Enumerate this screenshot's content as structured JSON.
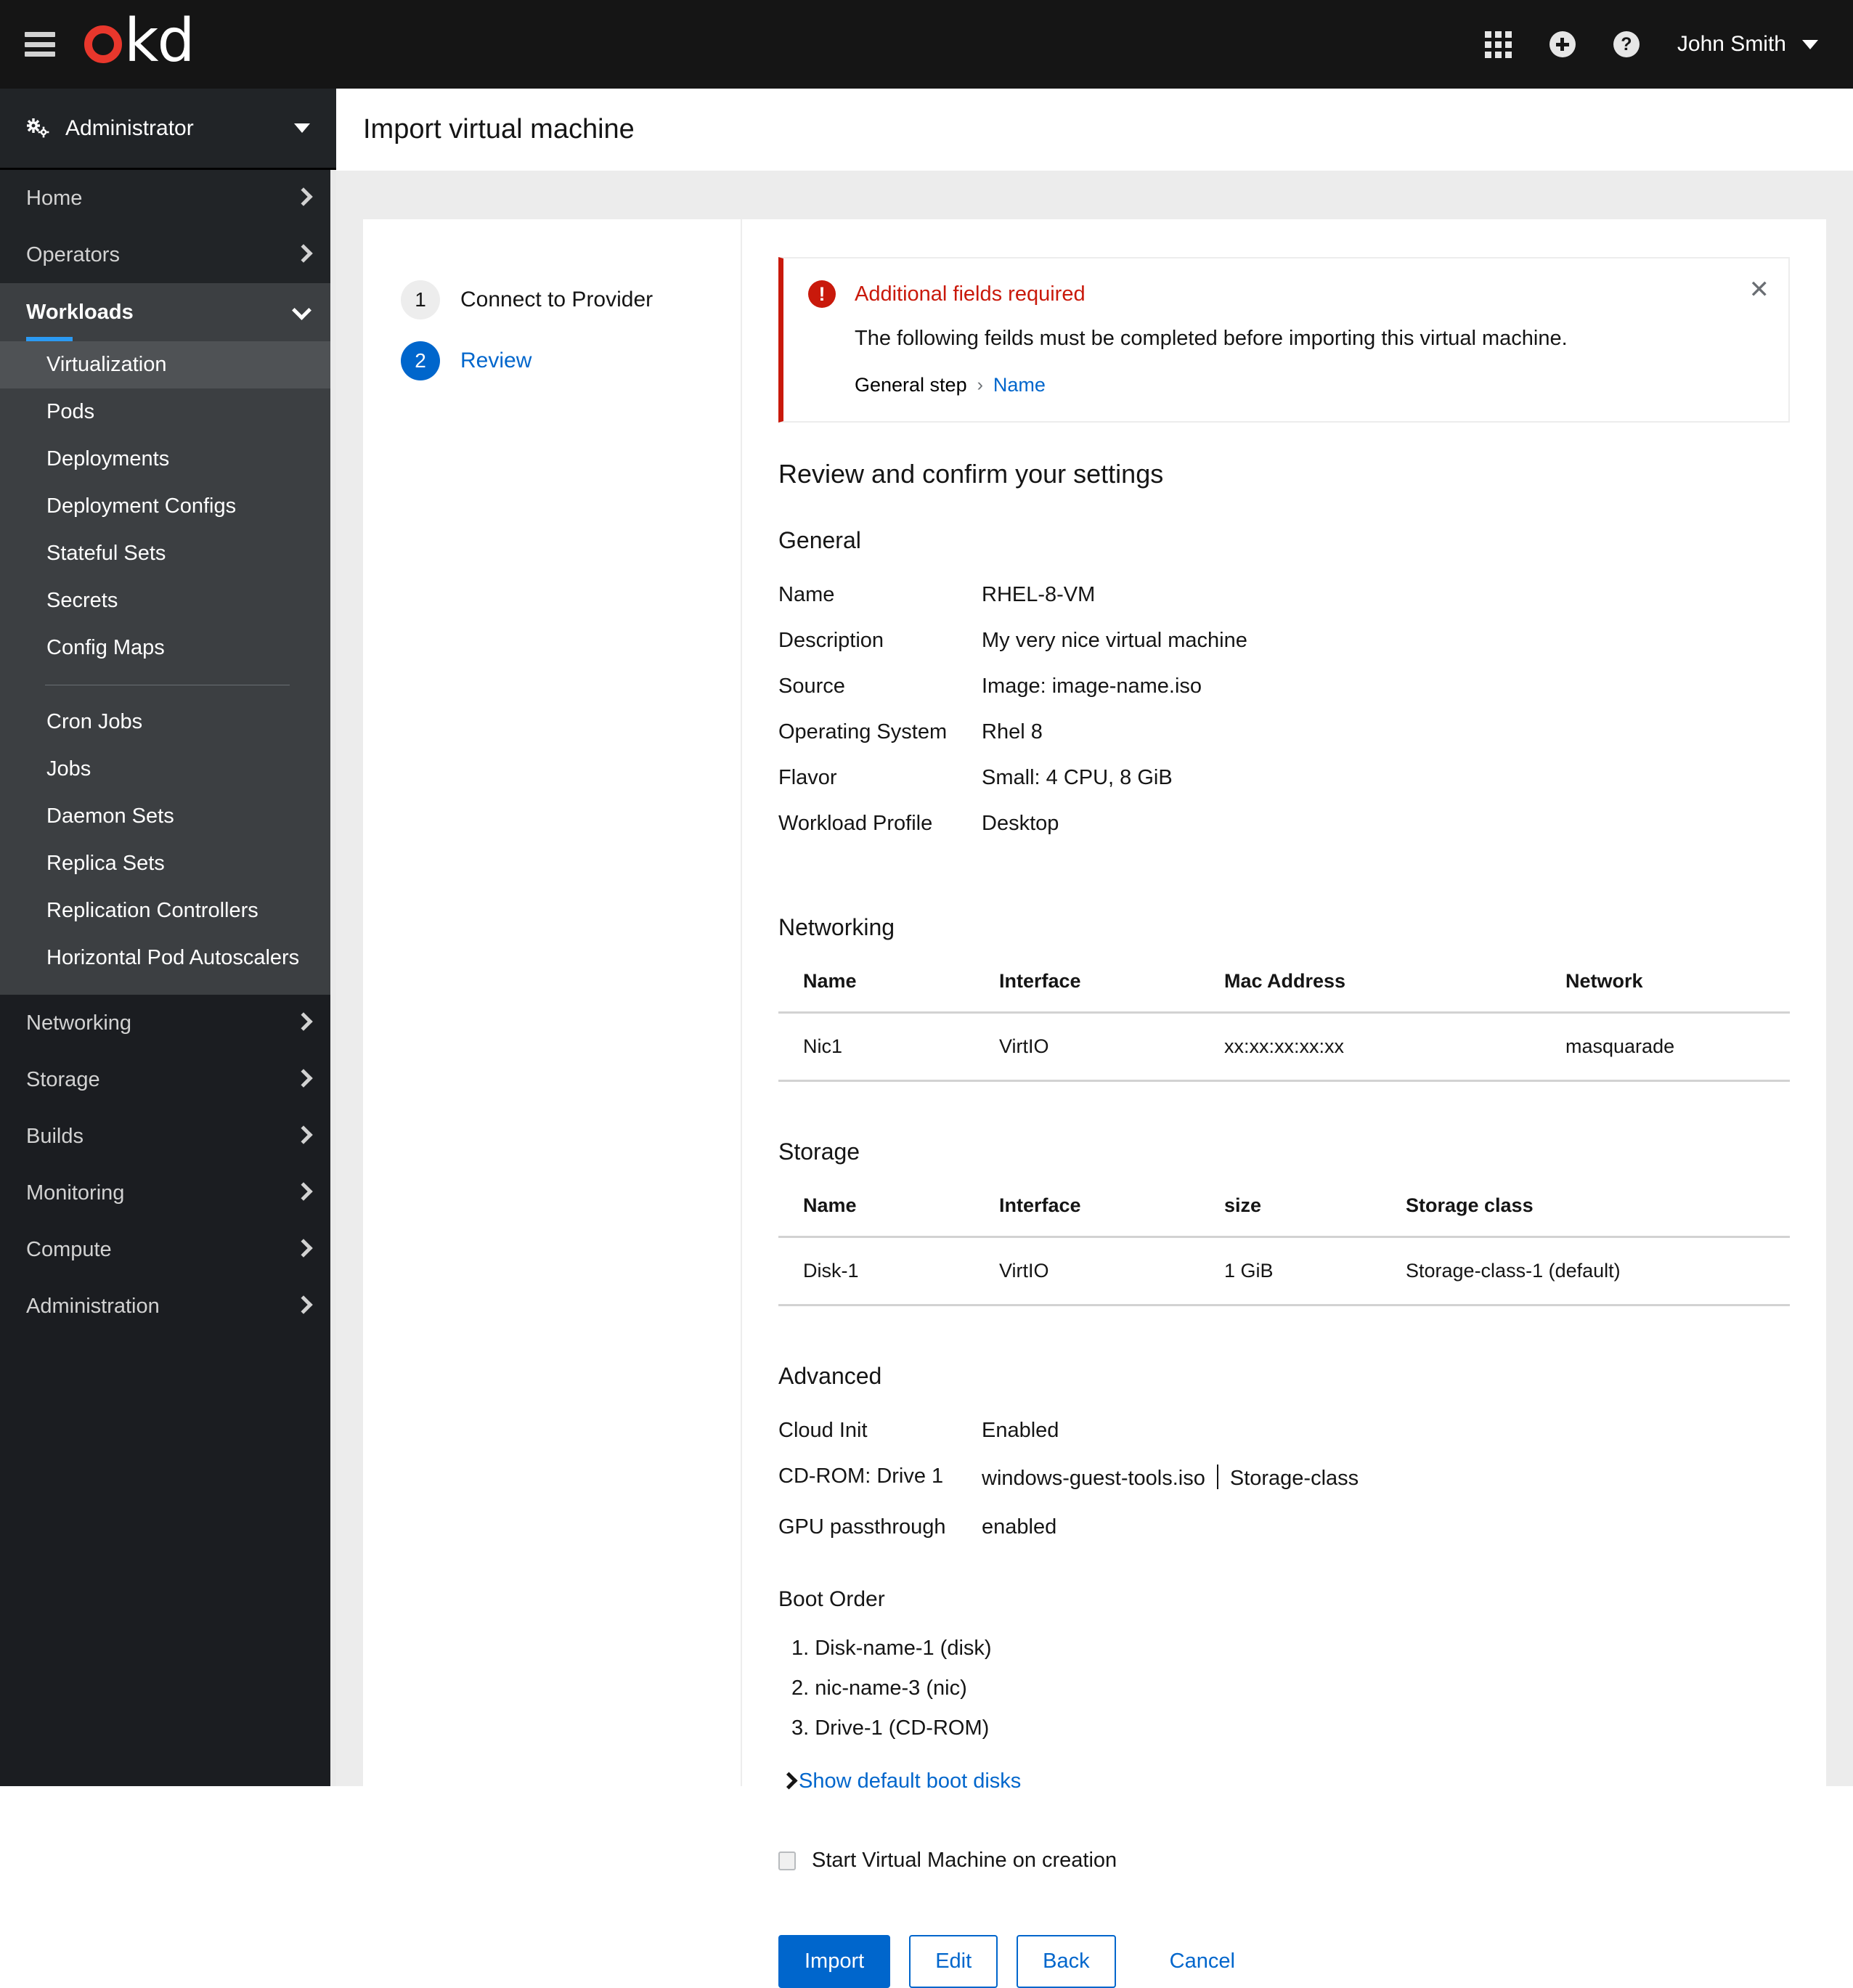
{
  "masthead": {
    "brand_o": "o",
    "brand_kd": "kd",
    "apps_icon": "grid-apps-icon",
    "add_icon": "plus-circle-icon",
    "help_icon": "?",
    "user_name": "John Smith"
  },
  "sidebar": {
    "perspective": "Administrator",
    "top_items": [
      {
        "label": "Home"
      },
      {
        "label": "Operators"
      }
    ],
    "workloads": {
      "label": "Workloads",
      "sub_items_group1": [
        {
          "label": "Virtualization",
          "active": true
        },
        {
          "label": "Pods",
          "active": false
        },
        {
          "label": "Deployments",
          "active": false
        },
        {
          "label": "Deployment Configs",
          "active": false
        },
        {
          "label": "Stateful Sets",
          "active": false
        },
        {
          "label": "Secrets",
          "active": false
        },
        {
          "label": "Config Maps",
          "active": false
        }
      ],
      "sub_items_group2": [
        {
          "label": "Cron Jobs"
        },
        {
          "label": "Jobs"
        },
        {
          "label": "Daemon Sets"
        },
        {
          "label": "Replica Sets"
        },
        {
          "label": "Replication Controllers"
        },
        {
          "label": "Horizontal Pod Autoscalers"
        }
      ]
    },
    "bottom_items": [
      {
        "label": "Networking"
      },
      {
        "label": "Storage"
      },
      {
        "label": "Builds"
      },
      {
        "label": "Monitoring"
      },
      {
        "label": "Compute"
      },
      {
        "label": "Administration"
      }
    ]
  },
  "page": {
    "title": "Import virtual machine"
  },
  "wizard": {
    "steps": [
      {
        "num": "1",
        "label": "Connect to Provider",
        "active": false
      },
      {
        "num": "2",
        "label": "Review",
        "active": true
      }
    ]
  },
  "alert": {
    "title": "Additional fields required",
    "body": "The following feilds must be completed before importing this virtual machine.",
    "breadcrumb_step": "General step",
    "breadcrumb_sep": "›",
    "breadcrumb_link": "Name",
    "close": "✕"
  },
  "review": {
    "heading": "Review and confirm your settings",
    "general": {
      "heading": "General",
      "rows": [
        {
          "key": "Name",
          "value": "RHEL-8-VM"
        },
        {
          "key": "Description",
          "value": "My very nice virtual machine"
        },
        {
          "key": "Source",
          "value": "Image: image-name.iso"
        },
        {
          "key": "Operating System",
          "value": "Rhel 8"
        },
        {
          "key": "Flavor",
          "value": "Small: 4 CPU, 8 GiB"
        },
        {
          "key": "Workload Profile",
          "value": "Desktop"
        }
      ]
    },
    "networking": {
      "heading": "Networking",
      "columns": [
        "Name",
        "Interface",
        "Mac Address",
        "Network"
      ],
      "rows": [
        {
          "name": "Nic1",
          "interface": "VirtIO",
          "mac": "xx:xx:xx:xx:xx",
          "network": "masquarade"
        }
      ]
    },
    "storage": {
      "heading": "Storage",
      "columns": [
        "Name",
        "Interface",
        "size",
        "Storage class"
      ],
      "rows": [
        {
          "name": "Disk-1",
          "interface": "VirtIO",
          "size": "1 GiB",
          "storage_class": "Storage-class-1 (default)"
        }
      ]
    },
    "advanced": {
      "heading": "Advanced",
      "rows": [
        {
          "key": "Cloud Init",
          "value": "Enabled"
        },
        {
          "key": "GPU passthrough",
          "value": "enabled"
        }
      ],
      "cdrom": {
        "key": "CD-ROM: Drive 1",
        "value_left": "windows-guest-tools.iso",
        "value_right": "Storage-class"
      }
    },
    "boot_order": {
      "heading": "Boot Order",
      "items": [
        "1. Disk-name-1 (disk)",
        "2. nic-name-3 (nic)",
        "3. Drive-1 (CD-ROM)"
      ],
      "show_defaults_link": "Show default boot disks"
    },
    "start_vm": {
      "label": "Start Virtual Machine on creation",
      "checked": false
    },
    "buttons": {
      "import": "Import",
      "edit": "Edit",
      "back": "Back",
      "cancel": "Cancel"
    }
  },
  "colors": {
    "accent_blue": "#0066cc",
    "danger_red": "#c9190b",
    "brand_red": "#e8372c",
    "active_nav_blue": "#2b9af3"
  }
}
